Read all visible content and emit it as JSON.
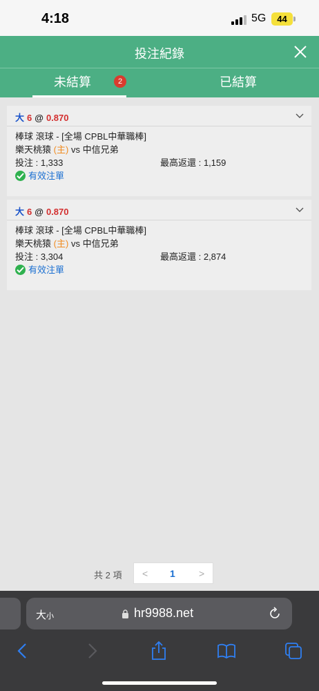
{
  "status_bar": {
    "time": "4:18",
    "network": "5G",
    "battery": "44"
  },
  "header": {
    "title": "投注紀錄",
    "close_icon": "close-icon"
  },
  "tabs": {
    "open": {
      "label": "未結算",
      "badge": "2"
    },
    "settled": {
      "label": "已結算"
    }
  },
  "bets": [
    {
      "side": "大",
      "line": "6",
      "at": "@",
      "odds": "0.870",
      "market": "棒球 滾球 - [全場 CPBL中華職棒]",
      "home_team": "樂天桃猿",
      "home_tag": "(主)",
      "vs": "vs",
      "away_team": "中信兄弟",
      "stake_label": "投注 : 1,333",
      "max_return_label": "最高返還 : 1,159",
      "status": "有效注單"
    },
    {
      "side": "大",
      "line": "6",
      "at": "@",
      "odds": "0.870",
      "market": "棒球 滾球 - [全場 CPBL中華職棒]",
      "home_team": "樂天桃猿",
      "home_tag": "(主)",
      "vs": "vs",
      "away_team": "中信兄弟",
      "stake_label": "投注 : 3,304",
      "max_return_label": "最高返還 : 2,874",
      "status": "有效注單"
    }
  ],
  "pagination": {
    "total": "共 2 項",
    "prev": "<",
    "current": "1",
    "next": ">"
  },
  "browser": {
    "text_size_label": "大",
    "text_size_small": "小",
    "url": "hr9988.net"
  },
  "colors": {
    "header_green": "#4caf84",
    "badge_red": "#d93b2e",
    "link_blue": "#1a6fd1",
    "odds_red": "#d32f2f"
  }
}
